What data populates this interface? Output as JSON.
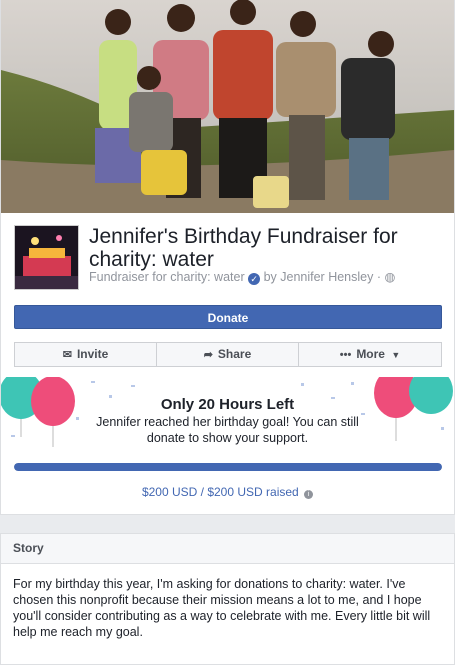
{
  "fundraiser": {
    "title": "Jennifer's Birthday Fundraiser for charity: water",
    "subtitle_prefix": "Fundraiser for charity: water",
    "subtitle_by": "by Jennifer Hensley ·"
  },
  "actions": {
    "donate": "Donate",
    "invite": "Invite",
    "share": "Share",
    "more": "More"
  },
  "goal": {
    "headline": "Only 20 Hours Left",
    "message": "Jennifer reached her birthday goal! You can still donate to show your support.",
    "progress_percent": 100,
    "raised_text": "$200 USD / $200 USD raised"
  },
  "story": {
    "heading": "Story",
    "body": "For my birthday this year, I'm asking for donations to charity: water. I've chosen this nonprofit because their mission means a lot to me, and I hope you'll consider contributing as a way to celebrate with me. Every little bit will help me reach my goal."
  },
  "colors": {
    "brand_blue": "#4267b2",
    "balloon_teal": "#3ec5b5",
    "balloon_pink": "#ee4d7a"
  },
  "icons": {
    "invite": "envelope-icon",
    "share": "share-arrow-icon",
    "more": "ellipsis-icon",
    "verified": "verified-badge-icon",
    "privacy": "globe-icon",
    "info": "info-icon"
  }
}
